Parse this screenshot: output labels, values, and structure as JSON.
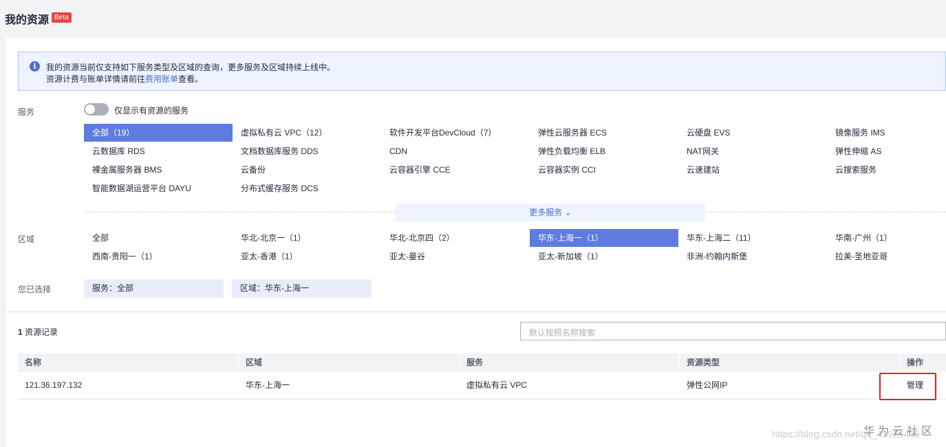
{
  "header": {
    "title": "我的资源",
    "badge": "Beta"
  },
  "notice": {
    "line1": "我的资源当前仅支持如下服务类型及区域的查询，更多服务及区域持续上线中。",
    "line2_prefix": "资源计费与账单详情请前往",
    "line2_link": "费用账单",
    "line2_suffix": "查看。"
  },
  "filters": {
    "service_label": "服务",
    "toggle_label": "仅显示有资源的服务",
    "toggle_on": false,
    "services": [
      "全部（19）",
      "虚拟私有云 VPC（12）",
      "软件开发平台DevCloud（7）",
      "弹性云服务器 ECS",
      "云硬盘 EVS",
      "镜像服务 IMS",
      "云数据库 RDS",
      "文档数据库服务 DDS",
      "CDN",
      "弹性负载均衡 ELB",
      "NAT网关",
      "弹性伸缩 AS",
      "裸金属服务器 BMS",
      "云备份",
      "云容器引擎 CCE",
      "云容器实例 CCI",
      "云速建站",
      "云搜索服务",
      "智能数据湖运营平台 DAYU",
      "分布式缓存服务 DCS"
    ],
    "services_active": 0,
    "more_label": "更多服务",
    "region_label": "区域",
    "regions": [
      "全部",
      "华北-北京一（1）",
      "华北-北京四（2）",
      "华东-上海一（1）",
      "华东-上海二（11）",
      "华南-广州（1）",
      "西南-贵阳一（1）",
      "亚太-香港（1）",
      "亚太-曼谷",
      "亚太-新加坡（1）",
      "非洲-约翰内斯堡",
      "拉美-圣地亚哥"
    ],
    "regions_active": 3,
    "selected_label": "您已选择",
    "selected": [
      "服务：全部",
      "区域：华东-上海一"
    ]
  },
  "results": {
    "count": "1",
    "count_suffix": " 资源记录",
    "search_placeholder": "默认按照名称搜索",
    "columns": [
      "名称",
      "区域",
      "服务",
      "资源类型",
      "操作"
    ],
    "rows": [
      {
        "name": "121.36.197.132",
        "region": "华东-上海一",
        "service": "虚拟私有云 VPC",
        "type": "弹性公网IP",
        "action": "管理"
      }
    ]
  },
  "watermark": {
    "brand": "华为云社区",
    "url": "https://blog.csdn.net/qq_41926435"
  },
  "colors": {
    "accent": "#5e7ce0",
    "link": "#526ecc",
    "highlight_box": "#e02020"
  }
}
